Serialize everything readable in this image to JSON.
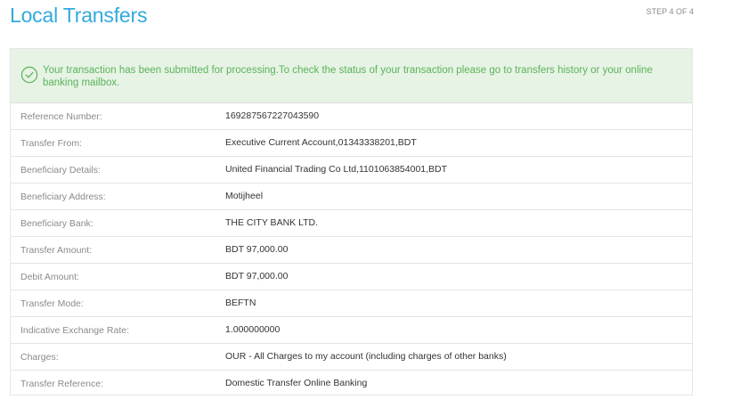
{
  "page": {
    "title": "Local Transfers",
    "step": "STEP 4 OF 4"
  },
  "alert": {
    "icon": "check-circle-icon",
    "message": "Your transaction has been submitted for processing.To check the status of your transaction please go to transfers history or your online banking mailbox.",
    "color": "#5cb35a"
  },
  "details": [
    {
      "label": "Reference Number:",
      "value": "169287567227043590"
    },
    {
      "label": "Transfer From:",
      "value": "Executive Current Account,01343338201,BDT"
    },
    {
      "label": "Beneficiary Details:",
      "value": "United Financial Trading Co Ltd,1101063854001,BDT"
    },
    {
      "label": "Beneficiary Address:",
      "value": "Motijheel"
    },
    {
      "label": "Beneficiary Bank:",
      "value": "THE CITY BANK LTD."
    },
    {
      "label": "Transfer Amount:",
      "value": "BDT 97,000.00"
    },
    {
      "label": "Debit Amount:",
      "value": "BDT 97,000.00"
    },
    {
      "label": "Transfer Mode:",
      "value": "BEFTN"
    },
    {
      "label": "Indicative Exchange Rate:",
      "value": "1.000000000"
    },
    {
      "label": "Charges:",
      "value": "OUR - All Charges to my account (including charges of other banks)"
    },
    {
      "label": "Transfer Reference:",
      "value": "Domestic Transfer Online Banking"
    }
  ]
}
